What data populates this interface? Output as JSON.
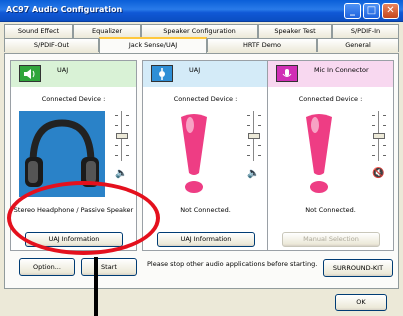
{
  "window": {
    "title": "AC97 Audio Configuration"
  },
  "tabs_row1": [
    {
      "label": "Sound Effect"
    },
    {
      "label": "Equalizer"
    },
    {
      "label": "Speaker Configuration"
    },
    {
      "label": "Speaker Test"
    },
    {
      "label": "S/PDIF-In"
    }
  ],
  "tabs_row2": [
    {
      "label": "S/PDIF-Out"
    },
    {
      "label": "Jack Sense/UAJ"
    },
    {
      "label": "HRTF Demo"
    },
    {
      "label": "General"
    }
  ],
  "active_tab": "Jack Sense/UAJ",
  "jacks": [
    {
      "label": "UAJ",
      "icon_color": "#2fa53a",
      "icon": "speaker-out-icon",
      "caption": "Connected Device :",
      "device": "headphone-icon",
      "status": "Stereo Headphone / Passive Speaker",
      "button": "UAJ Information",
      "button_enabled": true
    },
    {
      "label": "UAJ",
      "icon_color": "#2f8fd6",
      "icon": "line-in-icon",
      "caption": "Connected Device :",
      "device": "exclamation-icon",
      "status": "Not Connected.",
      "button": "UAJ Information",
      "button_enabled": true
    },
    {
      "label": "Mic In Connector",
      "icon_color": "#d02fb5",
      "icon": "mic-icon",
      "caption": "Connected Device :",
      "device": "exclamation-icon",
      "status": "Not Connected.",
      "button": "Manual Selection",
      "button_enabled": false
    }
  ],
  "bottom": {
    "option_label": "Option...",
    "start_label": "Start",
    "note": "Please stop other audio applications before starting.",
    "surround_label": "SURROUND-KIT",
    "ok_label": "OK"
  }
}
